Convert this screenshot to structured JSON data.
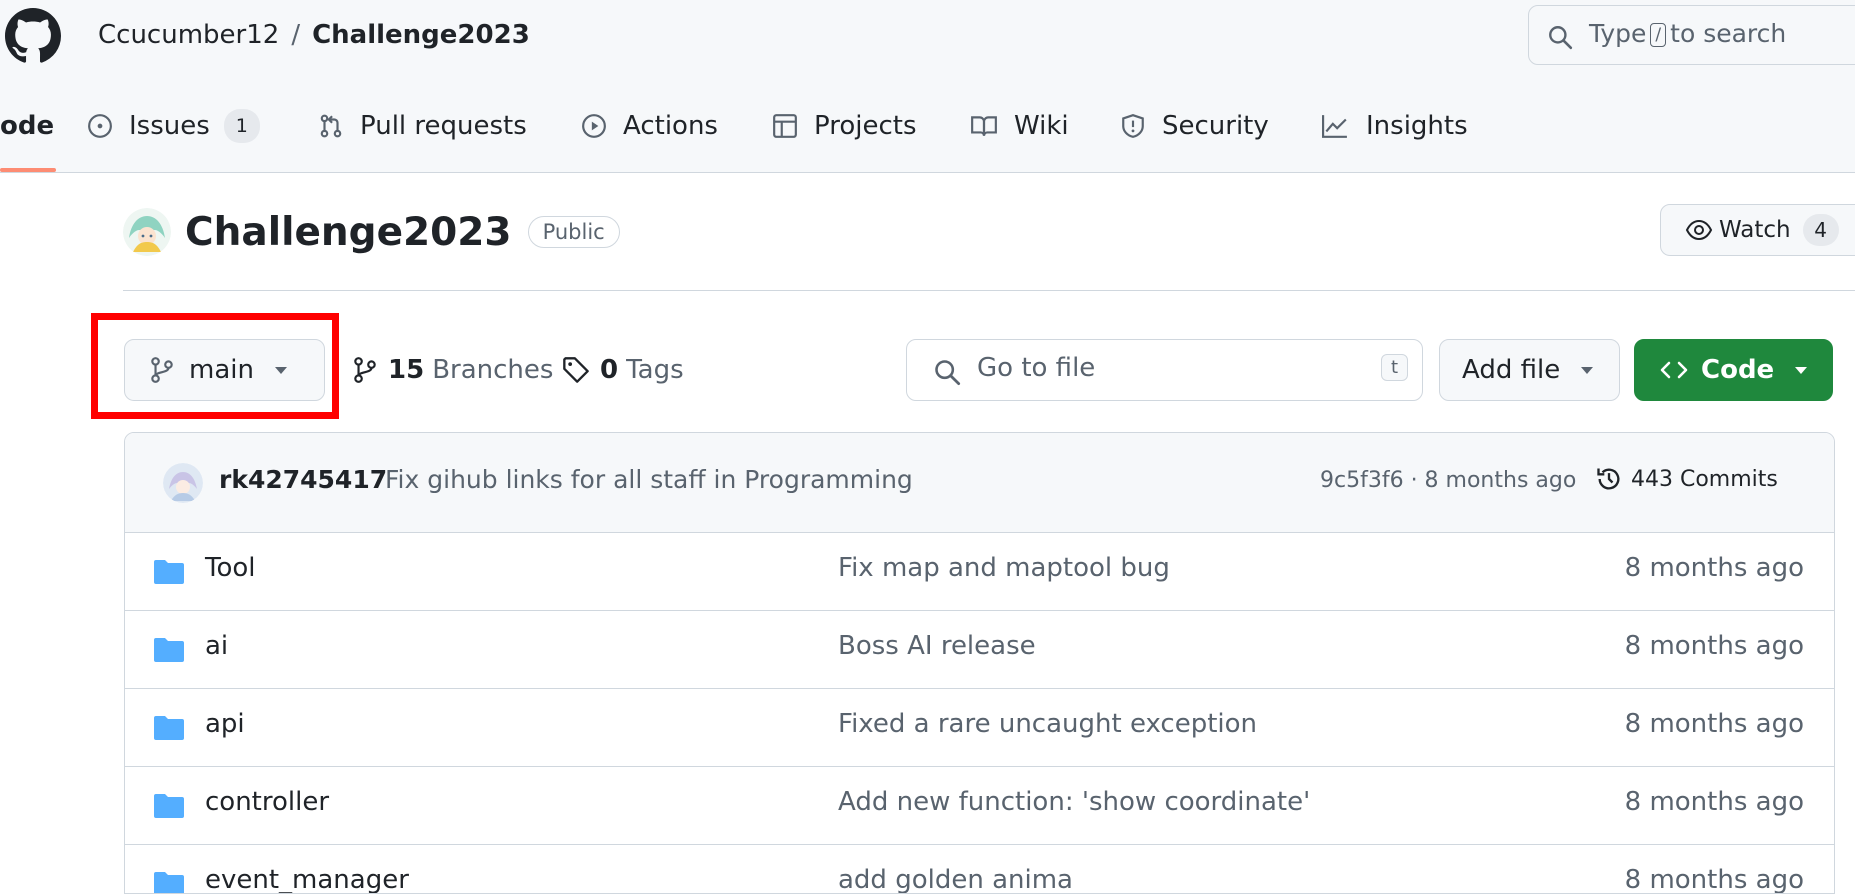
{
  "header": {
    "owner": "Ccucumber12",
    "separator": "/",
    "repo": "Challenge2023",
    "search": {
      "prefix": "Type",
      "key": "/",
      "suffix": "to search"
    }
  },
  "tabs": [
    {
      "label": "ode",
      "icon": "code-icon"
    },
    {
      "label": "Issues",
      "count": "1",
      "icon": "issue-icon"
    },
    {
      "label": "Pull requests",
      "icon": "pull-request-icon"
    },
    {
      "label": "Actions",
      "icon": "play-icon"
    },
    {
      "label": "Projects",
      "icon": "table-icon"
    },
    {
      "label": "Wiki",
      "icon": "book-icon"
    },
    {
      "label": "Security",
      "icon": "shield-icon"
    },
    {
      "label": "Insights",
      "icon": "graph-icon"
    }
  ],
  "repo": {
    "title": "Challenge2023",
    "visibility": "Public",
    "watch_label": "Watch",
    "watch_count": "4"
  },
  "toolbar": {
    "branch": "main",
    "branches_count": "15",
    "branches_label": "Branches",
    "tags_count": "0",
    "tags_label": "Tags",
    "goto_placeholder": "Go to file",
    "goto_key": "t",
    "add_file": "Add file",
    "code": "Code"
  },
  "commit": {
    "author": "rk42745417",
    "message": "Fix gihub links for all staff in Programming",
    "meta": "9c5f3f6 · 8 months ago",
    "commits": "443 Commits"
  },
  "files": [
    {
      "name": "Tool",
      "message": "Fix map and maptool bug",
      "date": "8 months ago"
    },
    {
      "name": "ai",
      "message": "Boss AI release",
      "date": "8 months ago"
    },
    {
      "name": "api",
      "message": "Fixed a rare uncaught exception",
      "date": "8 months ago"
    },
    {
      "name": "controller",
      "message": "Add new function: 'show coordinate'",
      "date": "8 months ago"
    },
    {
      "name": "event_manager",
      "message": "add golden anima",
      "date": "8 months ago"
    }
  ],
  "colors": {
    "accent": "#1f883d",
    "tab_underline": "#fd8c73",
    "folder": "#54aeff",
    "highlight": "#ff0000"
  }
}
